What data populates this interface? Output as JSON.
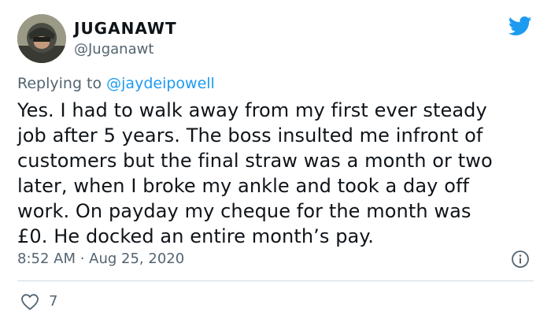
{
  "tweet": {
    "author_name": "JUGANAWT",
    "author_handle": "@Juganawt",
    "reply_prefix": "Replying to ",
    "reply_to": "@jaydeipowell",
    "body_lines": [
      "Yes. I had to walk away from my first ever steady",
      "job after 5 years. The boss insulted me infront of",
      "customers but the final straw was a month or two",
      "later, when I broke my ankle and took a day off",
      "work. On payday my cheque for the month was",
      "£0. He docked an entire month’s pay."
    ],
    "timestamp": "8:52 AM · Aug 25, 2020",
    "like_count": "7"
  },
  "icons": {
    "brand": "twitter-bird-icon",
    "info": "info-icon",
    "like": "heart-icon"
  },
  "colors": {
    "brand_blue": "#1d9bf0",
    "text_primary": "#0f1419",
    "text_secondary": "#536471",
    "divider": "#cfd9de"
  }
}
